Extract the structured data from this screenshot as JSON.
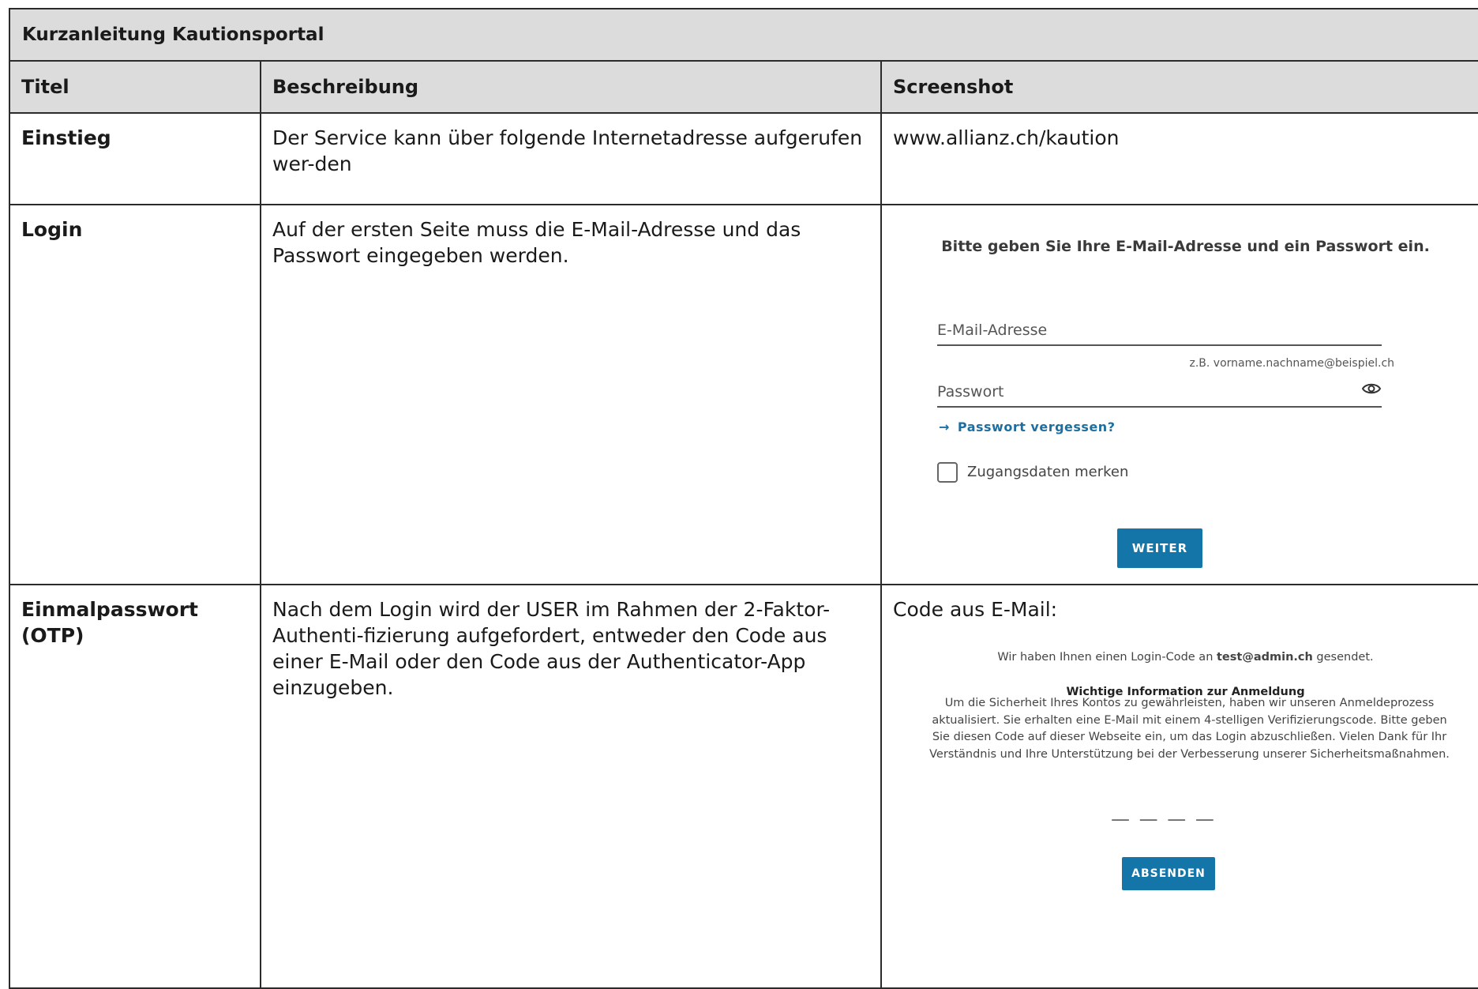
{
  "document": {
    "title": "Kurzanleitung Kautionsportal",
    "headers": [
      "Titel",
      "Beschreibung",
      "Screenshot"
    ]
  },
  "rows": {
    "einstieg": {
      "title": "Einstieg",
      "description": "Der Service kann über folgende Internetadresse aufgerufen wer-den",
      "screenshot": "www.allianz.ch/kaution"
    },
    "login": {
      "title": "Login",
      "description": "Auf der ersten Seite muss die E-Mail-Adresse und das Passwort eingegeben werden.",
      "screenshot": {
        "heading": "Bitte geben Sie Ihre E-Mail-Adresse und ein Passwort ein.",
        "email_label": "E-Mail-Adresse",
        "email_hint": "z.B. vorname.nachname@beispiel.ch",
        "password_label": "Passwort",
        "forgot_arrow": "→",
        "forgot_link": "Passwort vergessen?",
        "remember_label": "Zugangsdaten merken",
        "submit": "WEITER"
      }
    },
    "otp": {
      "title": "Einmalpasswort (OTP)",
      "description": "Nach dem Login wird der USER im Rahmen der 2-Faktor-Authenti-fizierung aufgefordert, entweder den Code aus einer E-Mail oder den Code aus der Authenticator-App einzugeben.",
      "screenshot_label": "Code aus E-Mail:",
      "screenshot": {
        "sent_prefix": "Wir haben Ihnen einen Login-Code an ",
        "sent_email": "test@admin.ch",
        "sent_suffix": " gesendet.",
        "info_title": "Wichtige Information zur Anmeldung",
        "info_text": "Um die Sicherheit Ihres Kontos zu gewährleisten, haben wir unseren Anmeldeprozess aktualisiert. Sie erhalten eine E-Mail mit einem 4-stelligen Verifizierungscode. Bitte geben Sie diesen Code auf dieser Webseite ein, um das Login abzuschließen. Vielen Dank für Ihr Verständnis und Ihre Unterstützung bei der Verbesserung unserer Sicherheitsmaßnahmen.",
        "code_placeholder": "— — — —",
        "submit": "ABSENDEN"
      }
    }
  },
  "colors": {
    "header_bg": "#dcdcdc",
    "border": "#2b2b2b",
    "button": "#1475a8",
    "link": "#1e6fa0"
  },
  "icons": [
    "eye-icon",
    "arrow-right-icon",
    "checkbox"
  ]
}
